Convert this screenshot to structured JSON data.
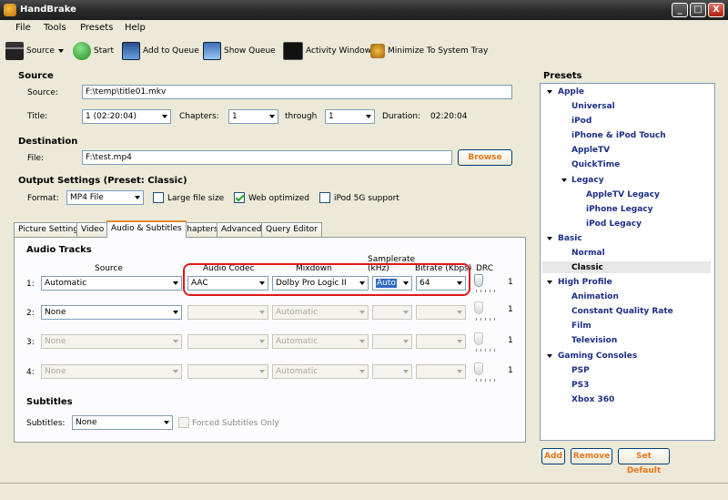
{
  "window": {
    "title": "HandBrake",
    "controls": [
      "_",
      "□",
      "X"
    ]
  },
  "menu": [
    "File",
    "Tools",
    "Presets",
    "Help"
  ],
  "toolbar": {
    "source": "Source",
    "start": "Start",
    "add_to_queue": "Add to Queue",
    "show_queue": "Show Queue",
    "activity_window": "Activity Window",
    "minimize": "Minimize To System Tray"
  },
  "source": {
    "heading": "Source",
    "source_label": "Source:",
    "source_value": "F:\\temp\\title01.mkv",
    "title_label": "Title:",
    "title_value": "1 (02:20:04)",
    "chapters_label": "Chapters:",
    "chapters_from": "1",
    "through_label": "through",
    "chapters_to": "1",
    "duration_label": "Duration:",
    "duration_value": "02:20:04"
  },
  "destination": {
    "heading": "Destination",
    "file_label": "File:",
    "file_value": "F:\\test.mp4",
    "browse": "Browse"
  },
  "output": {
    "heading": "Output Settings (Preset: Classic)",
    "format_label": "Format:",
    "format_value": "MP4 File",
    "large_file": "Large file size",
    "web_optimized": "Web optimized",
    "ipod_5g": "iPod 5G support"
  },
  "tabs": [
    "Picture Settings",
    "Video",
    "Audio & Subtitles",
    "Chapters",
    "Advanced",
    "Query Editor"
  ],
  "audio": {
    "heading": "Audio Tracks",
    "col_source": "Source",
    "col_codec": "Audio Codec",
    "col_mixdown": "Mixdown",
    "col_samplerate": "Samplerate",
    "col_samplerate_unit": "(kHz)",
    "col_bitrate": "Bitrate (Kbps)",
    "col_drc": "DRC",
    "tracks": [
      {
        "num": "1:",
        "source": "Automatic",
        "codec": "AAC",
        "mixdown": "Dolby Pro Logic II",
        "samplerate": "Auto",
        "bitrate": "64",
        "drc": "1"
      },
      {
        "num": "2:",
        "source": "None",
        "codec": "",
        "mixdown": "Automatic",
        "samplerate": "",
        "bitrate": "",
        "drc": "1"
      },
      {
        "num": "3:",
        "source": "None",
        "codec": "",
        "mixdown": "Automatic",
        "samplerate": "",
        "bitrate": "",
        "drc": "1"
      },
      {
        "num": "4:",
        "source": "None",
        "codec": "",
        "mixdown": "Automatic",
        "samplerate": "",
        "bitrate": "",
        "drc": "1"
      }
    ]
  },
  "subtitles": {
    "heading": "Subtitles",
    "label": "Subtitles:",
    "value": "None",
    "forced": "Forced Subtitles Only"
  },
  "presets": {
    "heading": "Presets",
    "apple": "Apple",
    "universal": "Universal",
    "ipod": "iPod",
    "iphone_ipod_touch": "iPhone & iPod Touch",
    "appletv": "AppleTV",
    "quicktime": "QuickTime",
    "legacy": "Legacy",
    "appletv_legacy": "AppleTV Legacy",
    "iphone_legacy": "iPhone Legacy",
    "ipod_legacy": "iPod Legacy",
    "basic": "Basic",
    "normal": "Normal",
    "classic": "Classic",
    "high_profile": "High Profile",
    "animation": "Animation",
    "constant_quality": "Constant Quality Rate",
    "film": "Film",
    "television": "Television",
    "gaming": "Gaming Consoles",
    "psp": "PSP",
    "ps3": "PS3",
    "xbox": "Xbox 360",
    "add": "Add",
    "remove": "Remove",
    "set_default": "Set Default"
  }
}
